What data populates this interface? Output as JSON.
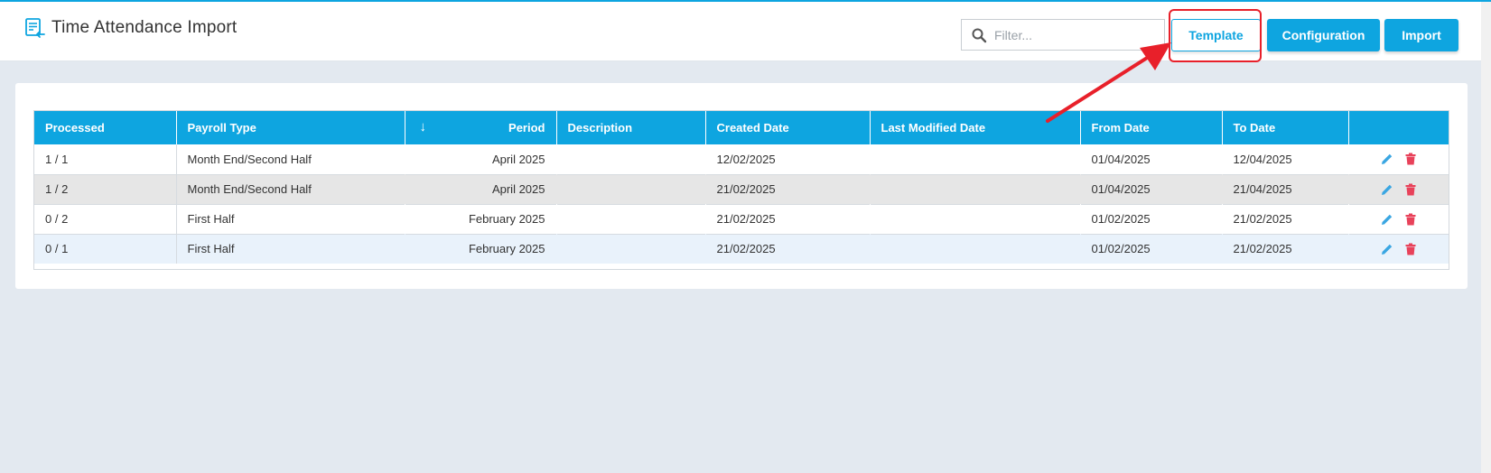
{
  "header": {
    "title": "Time Attendance Import",
    "filter_placeholder": "Filter...",
    "buttons": {
      "template": "Template",
      "configuration": "Configuration",
      "import": "Import"
    }
  },
  "table": {
    "sort_indicator": "↓",
    "columns": [
      "Processed",
      "Payroll Type",
      "",
      "Period",
      "Description",
      "Created Date",
      "Last Modified Date",
      "From Date",
      "To Date",
      ""
    ],
    "rows": [
      {
        "processed": "1 / 1",
        "payroll_type": "Month End/Second Half",
        "period": "April 2025",
        "description": "",
        "created_date": "12/02/2025",
        "last_modified_date": "",
        "from_date": "01/04/2025",
        "to_date": "12/04/2025"
      },
      {
        "processed": "1 / 2",
        "payroll_type": "Month End/Second Half",
        "period": "April 2025",
        "description": "",
        "created_date": "21/02/2025",
        "last_modified_date": "",
        "from_date": "01/04/2025",
        "to_date": "21/04/2025"
      },
      {
        "processed": "0 / 2",
        "payroll_type": "First Half",
        "period": "February 2025",
        "description": "",
        "created_date": "21/02/2025",
        "last_modified_date": "",
        "from_date": "01/02/2025",
        "to_date": "21/02/2025"
      },
      {
        "processed": "0 / 1",
        "payroll_type": "First Half",
        "period": "February 2025",
        "description": "",
        "created_date": "21/02/2025",
        "last_modified_date": "",
        "from_date": "01/02/2025",
        "to_date": "21/02/2025"
      }
    ]
  },
  "icons": {
    "title": "import-document-icon",
    "filter": "search-icon",
    "edit": "pencil-icon",
    "delete": "trash-icon"
  },
  "colors": {
    "accent": "#0ea5e0",
    "edit": "#3aa6e2",
    "delete": "#e8425a",
    "annotation": "#e8202a"
  }
}
